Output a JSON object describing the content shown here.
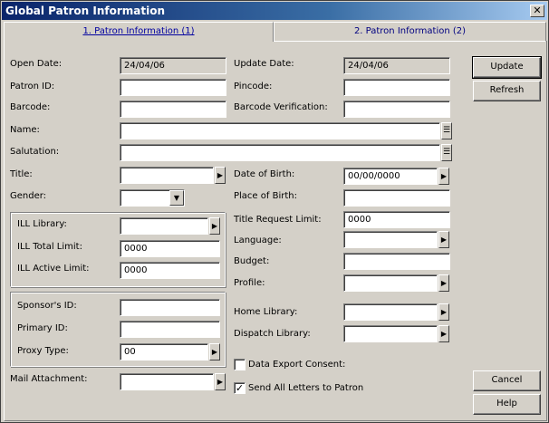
{
  "window": {
    "title": "Global Patron Information",
    "close_glyph": "✕"
  },
  "tabs": [
    {
      "label": "1. Patron Information (1)",
      "active": true
    },
    {
      "label": "2. Patron Information (2)",
      "active": false
    }
  ],
  "fields": {
    "open_date": {
      "label": "Open Date:",
      "value": "24/04/06"
    },
    "update_date": {
      "label": "Update Date:",
      "value": "24/04/06"
    },
    "patron_id": {
      "label": "Patron ID:",
      "value": ""
    },
    "pincode": {
      "label": "Pincode:",
      "value": ""
    },
    "barcode": {
      "label": "Barcode:",
      "value": ""
    },
    "barcode_verification": {
      "label": "Barcode Verification:",
      "value": ""
    },
    "name": {
      "label": "Name:",
      "value": ""
    },
    "salutation": {
      "label": "Salutation:",
      "value": ""
    },
    "title": {
      "label": "Title:",
      "value": ""
    },
    "date_of_birth": {
      "label": "Date of Birth:",
      "value": "00/00/0000"
    },
    "gender": {
      "label": "Gender:",
      "value": ""
    },
    "place_of_birth": {
      "label": "Place of Birth:",
      "value": ""
    },
    "ill_library": {
      "label": "ILL Library:",
      "value": ""
    },
    "title_request_limit": {
      "label": "Title Request Limit:",
      "value": "0000"
    },
    "ill_total_limit": {
      "label": "ILL Total Limit:",
      "value": "0000"
    },
    "language": {
      "label": "Language:",
      "value": ""
    },
    "ill_active_limit": {
      "label": "ILL Active Limit:",
      "value": "0000"
    },
    "budget": {
      "label": "Budget:",
      "value": ""
    },
    "profile": {
      "label": "Profile:",
      "value": ""
    },
    "sponsor_id": {
      "label": "Sponsor's ID:",
      "value": ""
    },
    "home_library": {
      "label": "Home Library:",
      "value": ""
    },
    "primary_id": {
      "label": "Primary ID:",
      "value": ""
    },
    "dispatch_library": {
      "label": "Dispatch Library:",
      "value": ""
    },
    "proxy_type": {
      "label": "Proxy Type:",
      "value": "00"
    },
    "mail_attachment": {
      "label": "Mail Attachment:",
      "value": ""
    }
  },
  "checkboxes": {
    "data_export_consent": {
      "label": "Data Export Consent:",
      "checked": false
    },
    "send_all_letters": {
      "label": "Send All Letters to Patron",
      "checked": true,
      "glyph": "✓"
    }
  },
  "buttons": {
    "update": "Update",
    "refresh": "Refresh",
    "cancel": "Cancel",
    "help": "Help"
  },
  "icons": {
    "arrow": "▶",
    "dropdown": "▼",
    "memo": "☰"
  }
}
